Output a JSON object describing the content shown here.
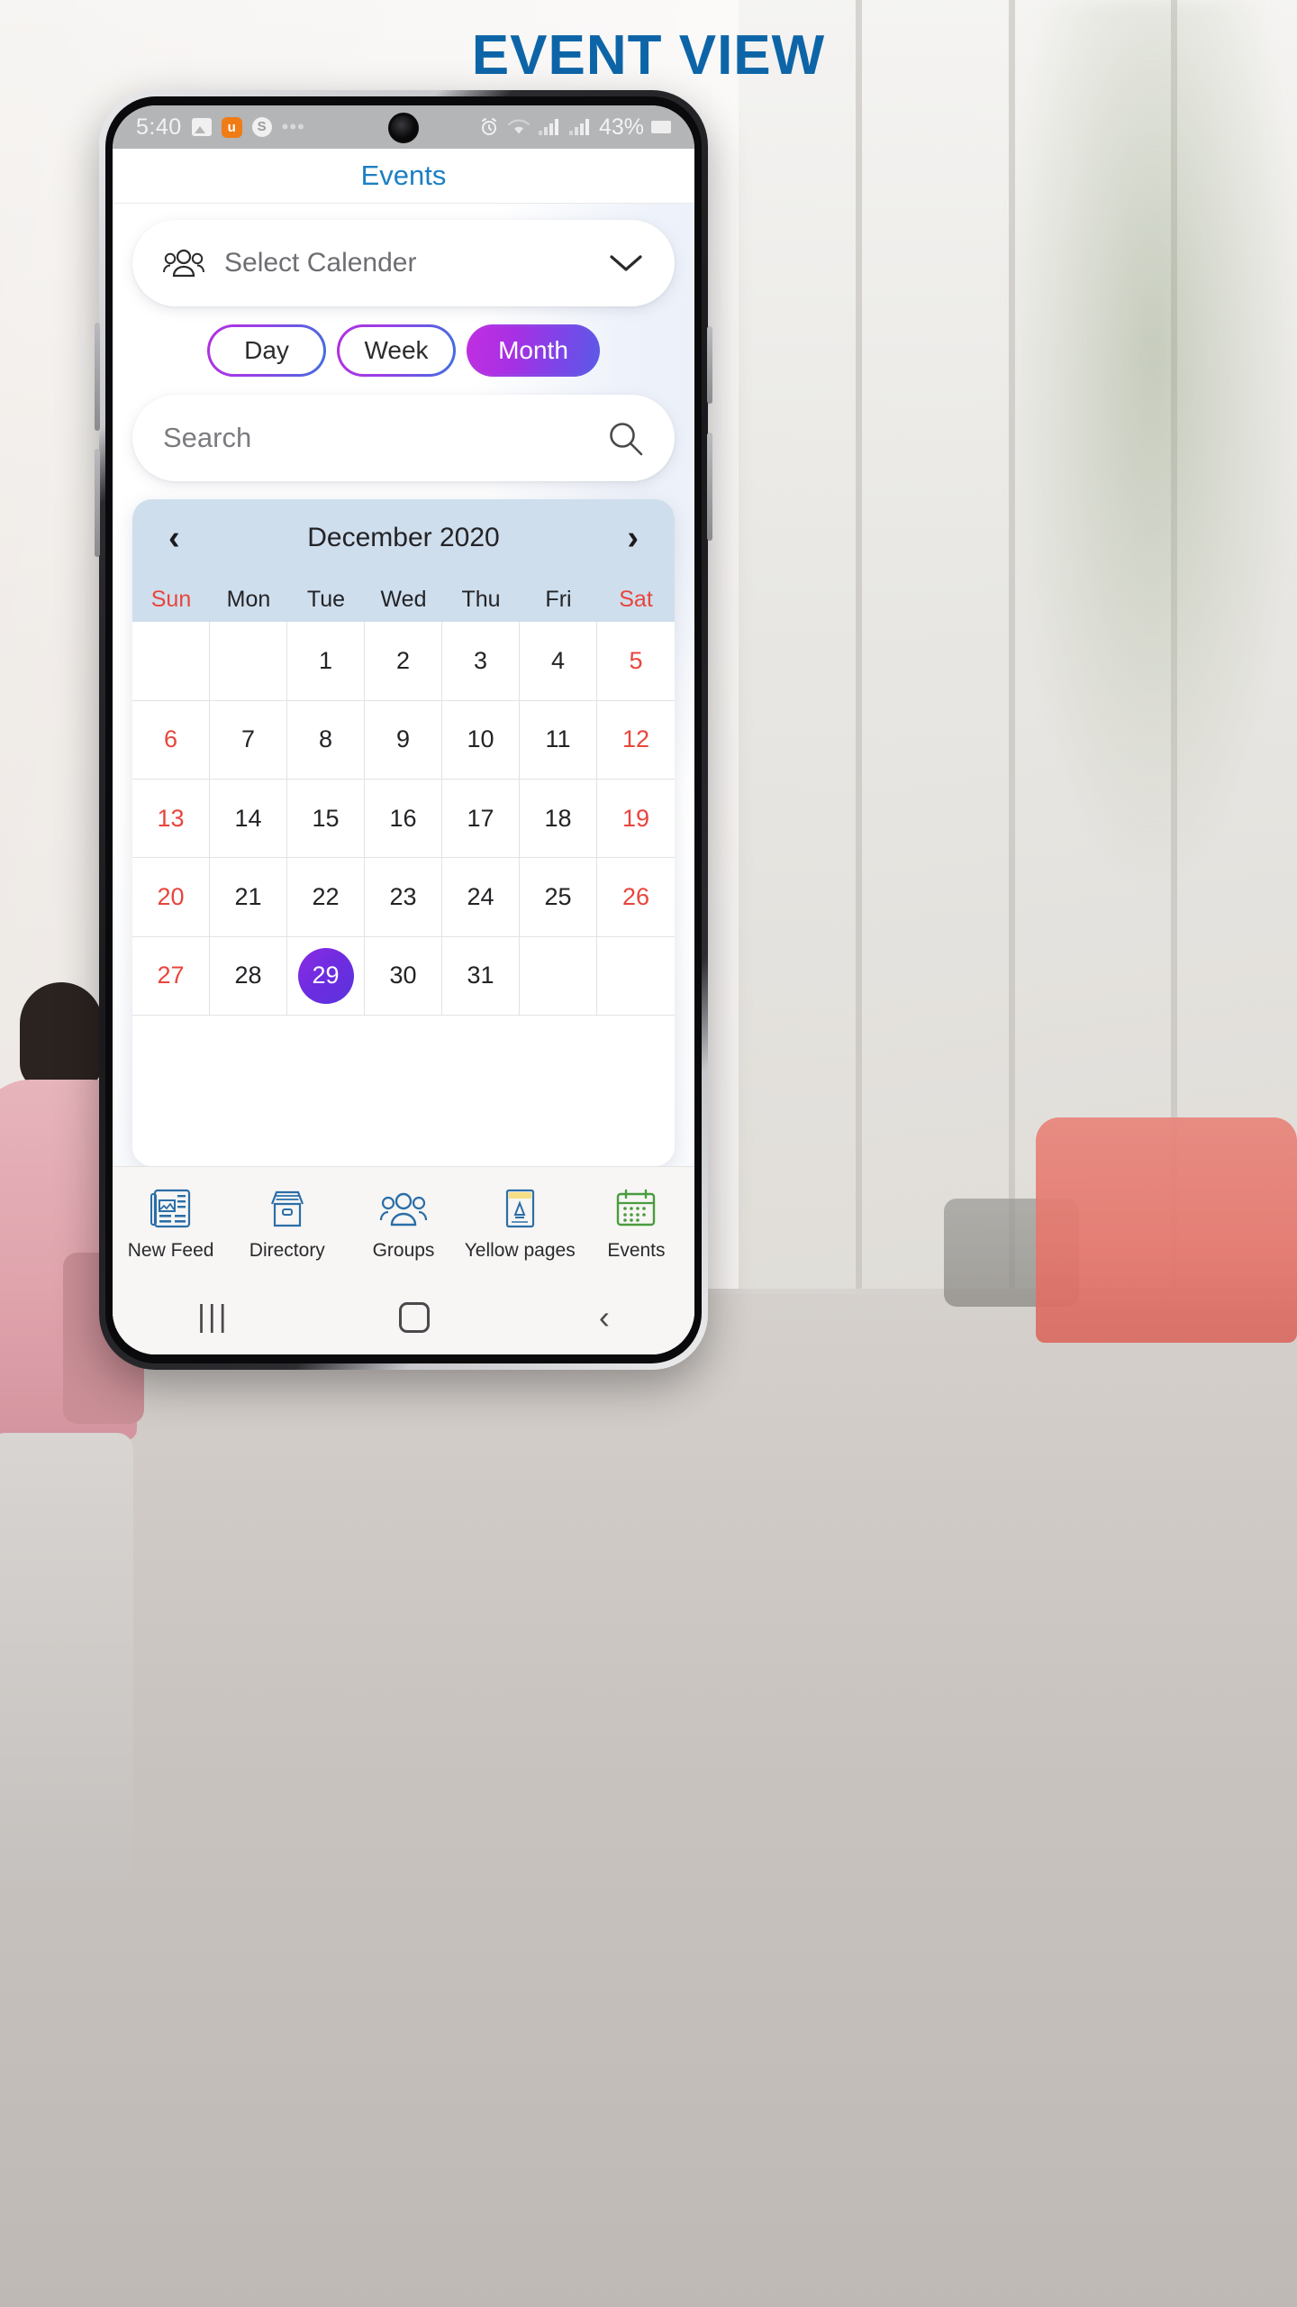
{
  "page": {
    "title": "EVENT VIEW",
    "title_color": "#0d65a8"
  },
  "statusbar": {
    "time": "5:40",
    "icons_left": [
      "image-icon",
      "u-app-icon",
      "s-app-icon",
      "more-dots-icon"
    ],
    "u_badge": "u",
    "s_badge": "S",
    "dots": "•••",
    "icons_right": [
      "alarm-icon",
      "wifi-icon",
      "signal-icon",
      "signal-icon"
    ],
    "battery_percent": "43%"
  },
  "app": {
    "header_title": "Events",
    "accent_blue": "#1c7fc4",
    "select_calendar": {
      "label": "Select Calender",
      "icon": "group-people-icon",
      "chevron": "chevron-down-icon"
    },
    "view_toggle": {
      "options": [
        "Day",
        "Week",
        "Month"
      ],
      "active": "Month",
      "gradient_start": "#c22ee0",
      "gradient_end": "#5a5ae6"
    },
    "search": {
      "value": "",
      "placeholder": "Search",
      "icon": "search-icon"
    },
    "calendar": {
      "month_label": "December 2020",
      "prev_arrow": "‹",
      "next_arrow": "›",
      "header_bg": "#cfdeec",
      "weekend_color": "#e8453c",
      "selected_color": "#6d2ce0",
      "weekdays": [
        "Sun",
        "Mon",
        "Tue",
        "Wed",
        "Thu",
        "Fri",
        "Sat"
      ],
      "selected_day": 29,
      "weeks": [
        [
          "",
          "",
          "1",
          "2",
          "3",
          "4",
          "5"
        ],
        [
          "6",
          "7",
          "8",
          "9",
          "10",
          "11",
          "12"
        ],
        [
          "13",
          "14",
          "15",
          "16",
          "17",
          "18",
          "19"
        ],
        [
          "20",
          "21",
          "22",
          "23",
          "24",
          "25",
          "26"
        ],
        [
          "27",
          "28",
          "29",
          "30",
          "31",
          "",
          ""
        ]
      ]
    },
    "bottom_nav": {
      "items": [
        {
          "label": "New Feed",
          "icon": "newspaper-icon",
          "active": false
        },
        {
          "label": "Directory",
          "icon": "file-box-icon",
          "active": false
        },
        {
          "label": "Groups",
          "icon": "group-people-icon",
          "active": false
        },
        {
          "label": "Yellow pages",
          "icon": "yellow-pages-book-icon",
          "active": false
        },
        {
          "label": "Events",
          "icon": "calendar-icon",
          "active": true
        }
      ],
      "inactive_color": "#2b6ea8",
      "active_color": "#4a9b3f"
    }
  },
  "android_nav": {
    "recent": "|||",
    "home": "home-square-icon",
    "back": "‹"
  }
}
